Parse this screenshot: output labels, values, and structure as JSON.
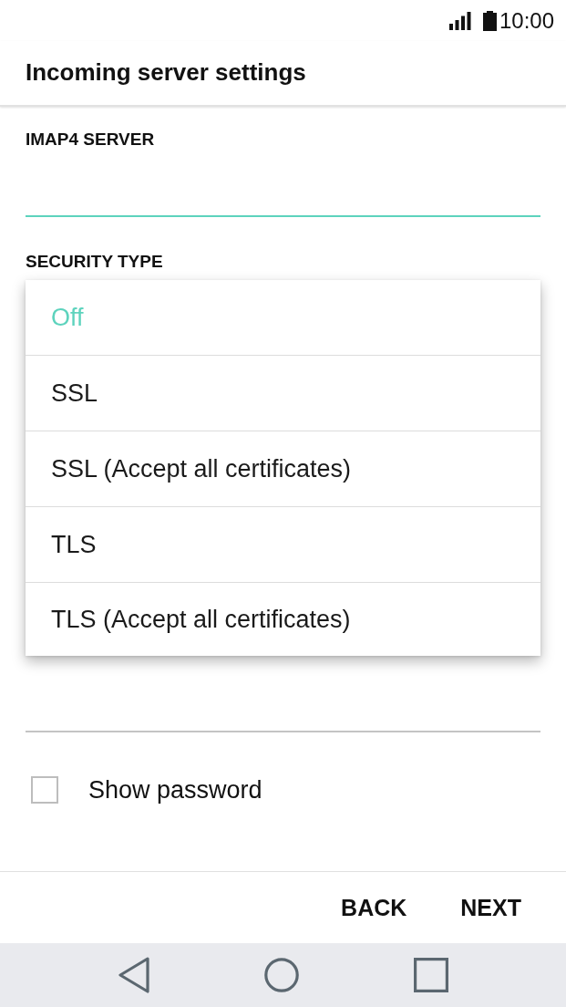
{
  "status_bar": {
    "time": "10:00"
  },
  "header": {
    "title": "Incoming server settings"
  },
  "form": [
    {
      "kind": "text",
      "label": "IMAP4 SERVER",
      "focused": true
    },
    {
      "kind": "select",
      "label": "SECURITY TYPE",
      "expanded": true,
      "options": [
        {
          "label": "Off",
          "selected": true
        },
        {
          "label": "SSL",
          "selected": false
        },
        {
          "label": "SSL (Accept all certificates)",
          "selected": false
        },
        {
          "label": "TLS",
          "selected": false
        },
        {
          "label": "TLS (Accept all certificates)",
          "selected": false
        }
      ]
    },
    {
      "kind": "text",
      "focused": false
    }
  ],
  "show_password": {
    "label": "Show password",
    "checked": false
  },
  "buttons": [
    {
      "label": "BACK"
    },
    {
      "label": "NEXT"
    }
  ]
}
